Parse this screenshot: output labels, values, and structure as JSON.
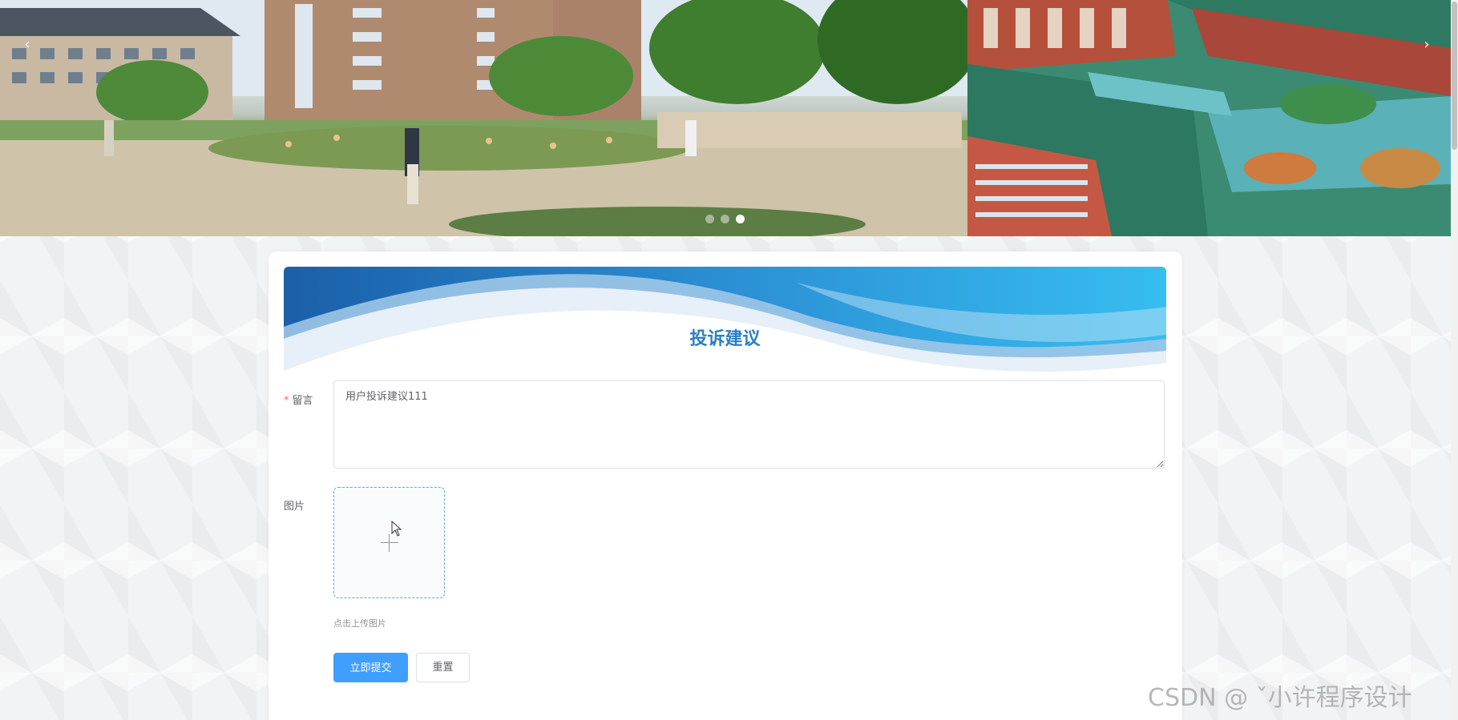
{
  "carousel": {
    "dots": 3,
    "active_index": 2,
    "prev_arrow": "‹",
    "next_arrow": "›"
  },
  "form": {
    "title": "投诉建议",
    "message_label": "留言",
    "message_required_mark": "*",
    "message_value": "用户投诉建议111",
    "image_label": "图片",
    "upload_hint": "点击上传图片",
    "submit_label": "立即提交",
    "reset_label": "重置"
  },
  "watermark": "CSDN @ ˇ小许程序设计",
  "colors": {
    "primary": "#409eff",
    "title": "#2a7fc4",
    "required": "#f56c6c"
  }
}
